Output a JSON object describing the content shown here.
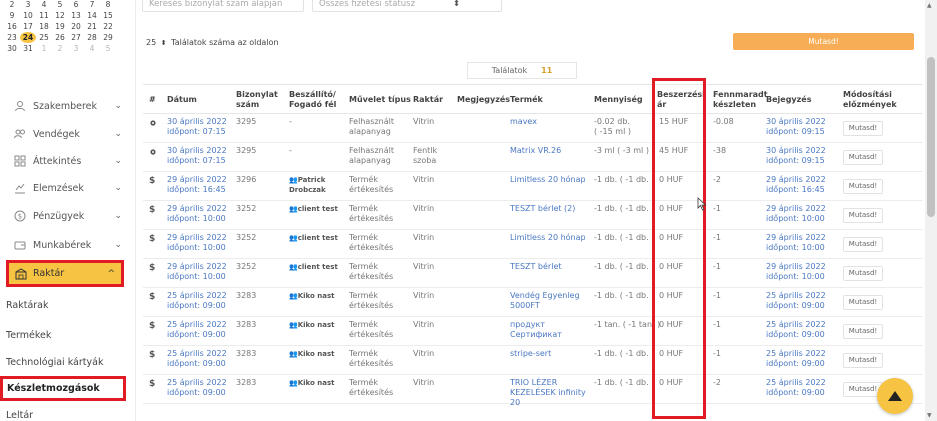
{
  "calendar": {
    "rows": [
      [
        {
          "d": "2"
        },
        {
          "d": "3"
        },
        {
          "d": "4"
        },
        {
          "d": "5"
        },
        {
          "d": "6"
        },
        {
          "d": "7"
        },
        {
          "d": "8"
        }
      ],
      [
        {
          "d": "9"
        },
        {
          "d": "10"
        },
        {
          "d": "11"
        },
        {
          "d": "12"
        },
        {
          "d": "13"
        },
        {
          "d": "14"
        },
        {
          "d": "15"
        }
      ],
      [
        {
          "d": "16"
        },
        {
          "d": "17"
        },
        {
          "d": "18"
        },
        {
          "d": "19"
        },
        {
          "d": "20"
        },
        {
          "d": "21"
        },
        {
          "d": "22"
        }
      ],
      [
        {
          "d": "23"
        },
        {
          "d": "24",
          "today": true
        },
        {
          "d": "25"
        },
        {
          "d": "26"
        },
        {
          "d": "27"
        },
        {
          "d": "28"
        },
        {
          "d": "29"
        }
      ],
      [
        {
          "d": "30"
        },
        {
          "d": "31"
        },
        {
          "d": "1",
          "dim": true
        },
        {
          "d": "2",
          "dim": true
        },
        {
          "d": "3",
          "dim": true
        },
        {
          "d": "4",
          "dim": true
        },
        {
          "d": "5",
          "dim": true
        }
      ]
    ]
  },
  "sidebar": {
    "items": [
      {
        "label": "Szakemberek",
        "icon": "person-icon"
      },
      {
        "label": "Vendégek",
        "icon": "group-icon"
      },
      {
        "label": "Áttekintés",
        "icon": "grid-icon"
      },
      {
        "label": "Elemzések",
        "icon": "chart-icon"
      },
      {
        "label": "Pénzügyek",
        "icon": "dollar-icon"
      },
      {
        "label": "Munkabérek",
        "icon": "wallet-icon"
      }
    ],
    "active": {
      "label": "Raktár",
      "icon": "warehouse-icon"
    },
    "subitems": [
      "Raktárak",
      "Termékek",
      "Technológiai kártyák"
    ],
    "active_sub": "Készletmozgások",
    "last_sub": "Leltár"
  },
  "filters": {
    "search_placeholder": "Keresés bizonylat szám alapján",
    "status_placeholder": "Összes fizetési státusz",
    "per_page": "25",
    "per_page_label": "Találatok száma az oldalon",
    "show_button": "Mutasd!"
  },
  "results": {
    "label": "Találatok",
    "count": "11"
  },
  "table": {
    "headers": {
      "num": "#",
      "date": "Dátum",
      "doc": "Bizonylat szám",
      "supplier": "Beszállító/ Fogadó fél",
      "op": "Művelet típus",
      "warehouse": "Raktár",
      "note": "Megjegyzés",
      "product": "Termék",
      "qty": "Mennyiség",
      "price": "Beszerzési ár",
      "remaining": "Fennmaradt készleten",
      "entry": "Bejegyzés",
      "history": "Módosítási előzmények"
    },
    "rows": [
      {
        "icon": "gear",
        "date1": "30 április 2022",
        "date2": "időpont: 07:15",
        "doc": "3295",
        "supplier": "-",
        "sup_bold": false,
        "op1": "Felhasznált",
        "op2": "alapanyag",
        "wh1": "Vitrin",
        "wh2": "",
        "product1": "mavex",
        "product2": "",
        "qty1": "-0.02 db.",
        "qty2": "( -15 ml )",
        "price": "15 HUF",
        "rem": "-0.08",
        "entry1": "30 április 2022",
        "entry2": "időpont: 09:15",
        "btn": "Mutasd!"
      },
      {
        "icon": "gear",
        "date1": "30 április 2022",
        "date2": "időpont: 07:15",
        "doc": "3295",
        "supplier": "-",
        "sup_bold": false,
        "op1": "Felhasznált",
        "op2": "alapanyag",
        "wh1": "Fentlk",
        "wh2": "szoba",
        "product1": "Matrix VR.26",
        "product2": "",
        "qty1": "-3 ml ( -3 ml )",
        "qty2": "",
        "price": "45 HUF",
        "rem": "-38",
        "entry1": "30 április 2022",
        "entry2": "időpont: 09:15",
        "btn": "Mutasd!"
      },
      {
        "icon": "$",
        "date1": "29 április 2022",
        "date2": "időpont: 16:45",
        "doc": "3296",
        "supplier": "Patrick",
        "supplier2": "Drobczak",
        "sup_bold": true,
        "op1": "Termék",
        "op2": "értékesítés",
        "wh1": "Vitrin",
        "wh2": "",
        "product1": "Limitless 20 hónap",
        "product2": "",
        "qty1": "-1 db. ( -1 db. )",
        "qty2": "",
        "price": "0 HUF",
        "rem": "-2",
        "entry1": "29 április 2022",
        "entry2": "időpont: 16:45",
        "btn": "Mutasd!"
      },
      {
        "icon": "$",
        "date1": "29 április 2022",
        "date2": "időpont: 10:00",
        "doc": "3252",
        "supplier": "client test",
        "sup_bold": true,
        "op1": "Termék",
        "op2": "értékesítés",
        "wh1": "Vitrin",
        "wh2": "",
        "product1": "TESZT bérlet (2)",
        "product2": "",
        "qty1": "-1 db. ( -1 db. )",
        "qty2": "",
        "price": "0 HUF",
        "rem": "-1",
        "entry1": "29 április 2022",
        "entry2": "időpont: 10:00",
        "btn": "Mutasd!"
      },
      {
        "icon": "$",
        "date1": "29 április 2022",
        "date2": "időpont: 10:00",
        "doc": "3252",
        "supplier": "client test",
        "sup_bold": true,
        "op1": "Termék",
        "op2": "értékesítés",
        "wh1": "Vitrin",
        "wh2": "",
        "product1": "Limitless 20 hónap",
        "product2": "",
        "qty1": "-1 db. ( -1 db. )",
        "qty2": "",
        "price": "0 HUF",
        "rem": "-1",
        "entry1": "29 április 2022",
        "entry2": "időpont: 10:00",
        "btn": "Mutasd!"
      },
      {
        "icon": "$",
        "date1": "29 április 2022",
        "date2": "időpont: 10:00",
        "doc": "3252",
        "supplier": "client test",
        "sup_bold": true,
        "op1": "Termék",
        "op2": "értékesítés",
        "wh1": "Vitrin",
        "wh2": "",
        "product1": "TESZT bérlet",
        "product2": "",
        "qty1": "-1 db. ( -1 db. )",
        "qty2": "",
        "price": "0 HUF",
        "rem": "-1",
        "entry1": "29 április 2022",
        "entry2": "időpont: 10:00",
        "btn": "Mutasd!"
      },
      {
        "icon": "$",
        "date1": "25 április 2022",
        "date2": "időpont: 09:00",
        "doc": "3283",
        "supplier": "Kiko nast",
        "sup_bold": true,
        "op1": "Termék",
        "op2": "értékesítés",
        "wh1": "Vitrin",
        "wh2": "",
        "product1": "Vendég Egyenleg",
        "product2": "5000FT",
        "qty1": "-1 db. ( -1 db. )",
        "qty2": "",
        "price": "0 HUF",
        "rem": "-1",
        "entry1": "25 április 2022",
        "entry2": "időpont: 09:00",
        "btn": "Mutasd!"
      },
      {
        "icon": "$",
        "date1": "25 április 2022",
        "date2": "időpont: 09:00",
        "doc": "3283",
        "supplier": "Kiko nast",
        "sup_bold": true,
        "op1": "Termék",
        "op2": "értékesítés",
        "wh1": "Vitrin",
        "wh2": "",
        "product1": "продукт",
        "product2": "Сертификат",
        "qty1": "-1 tan. ( -1 tan. )",
        "qty2": "",
        "price": "0 HUF",
        "rem": "-1",
        "entry1": "25 április 2022",
        "entry2": "időpont: 09:00",
        "btn": "Mutasd!"
      },
      {
        "icon": "$",
        "date1": "25 április 2022",
        "date2": "időpont: 09:00",
        "doc": "3283",
        "supplier": "Kiko nast",
        "sup_bold": true,
        "op1": "Termék",
        "op2": "értékesítés",
        "wh1": "Vitrin",
        "wh2": "",
        "product1": "stripe-sert",
        "product2": "",
        "qty1": "-1 db. ( -1 db. )",
        "qty2": "",
        "price": "0 HUF",
        "rem": "-1",
        "entry1": "25 április 2022",
        "entry2": "időpont: 09:00",
        "btn": "Mutasd!"
      },
      {
        "icon": "$",
        "date1": "25 április 2022",
        "date2": "időpont: 09:00",
        "doc": "3283",
        "supplier": "Kiko nast",
        "sup_bold": true,
        "op1": "Termék",
        "op2": "értékesítés",
        "wh1": "Vitrin",
        "wh2": "",
        "product1": "TRIO LÉZER",
        "product2": "KEZELÉSEK infinity",
        "product3": "20",
        "qty1": "-1 db. ( -1 db. )",
        "qty2": "",
        "price": "0 HUF",
        "rem": "-2",
        "entry1": "25 április 2022",
        "entry2": "időpont: 09:00",
        "btn": "Mutasd!"
      }
    ]
  },
  "colors": {
    "accent": "#f6c343",
    "button": "#f6ad55",
    "highlight": "#e01b24",
    "link": "#4a78c2"
  }
}
